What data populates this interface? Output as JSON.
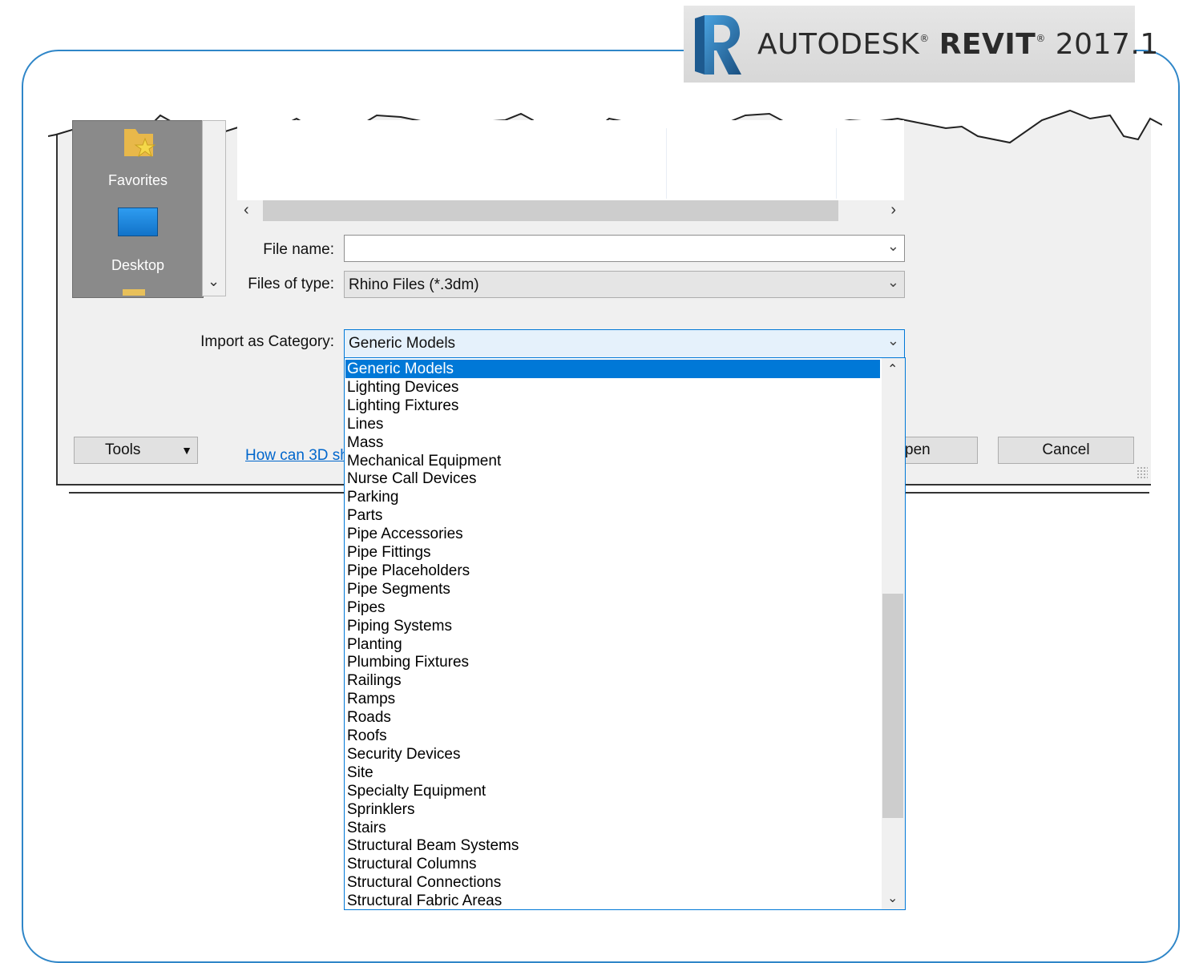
{
  "brand": {
    "name_prefix": "AUTODESK",
    "reg": "®",
    "product": "REVIT",
    "version": "2017.1",
    "logo_letter": "R",
    "color": "#2a6ea8"
  },
  "places": {
    "favorites": "Favorites",
    "desktop": "Desktop"
  },
  "fields": {
    "file_name_label": "File name:",
    "file_name_value": "",
    "files_of_type_label": "Files of type:",
    "files_of_type_value": "Rhino Files  (*.3dm)",
    "import_category_label": "Import as Category:",
    "import_category_value": "Generic Models"
  },
  "buttons": {
    "tools": "Tools",
    "open_partial": "pen",
    "cancel": "Cancel"
  },
  "link_text_partial": "How can 3D sh",
  "dropdown": {
    "selected_index": 0,
    "options": [
      "Generic Models",
      "Lighting Devices",
      "Lighting Fixtures",
      "Lines",
      "Mass",
      "Mechanical Equipment",
      "Nurse Call Devices",
      "Parking",
      "Parts",
      "Pipe Accessories",
      "Pipe Fittings",
      "Pipe Placeholders",
      "Pipe Segments",
      "Pipes",
      "Piping Systems",
      "Planting",
      "Plumbing Fixtures",
      "Railings",
      "Ramps",
      "Roads",
      "Roofs",
      "Security Devices",
      "Site",
      "Specialty Equipment",
      "Sprinklers",
      "Stairs",
      "Structural Beam Systems",
      "Structural Columns",
      "Structural Connections",
      "Structural Fabric Areas"
    ]
  },
  "colors": {
    "accent": "#0078d7",
    "frame": "#2f86c8",
    "link": "#0066cc"
  }
}
